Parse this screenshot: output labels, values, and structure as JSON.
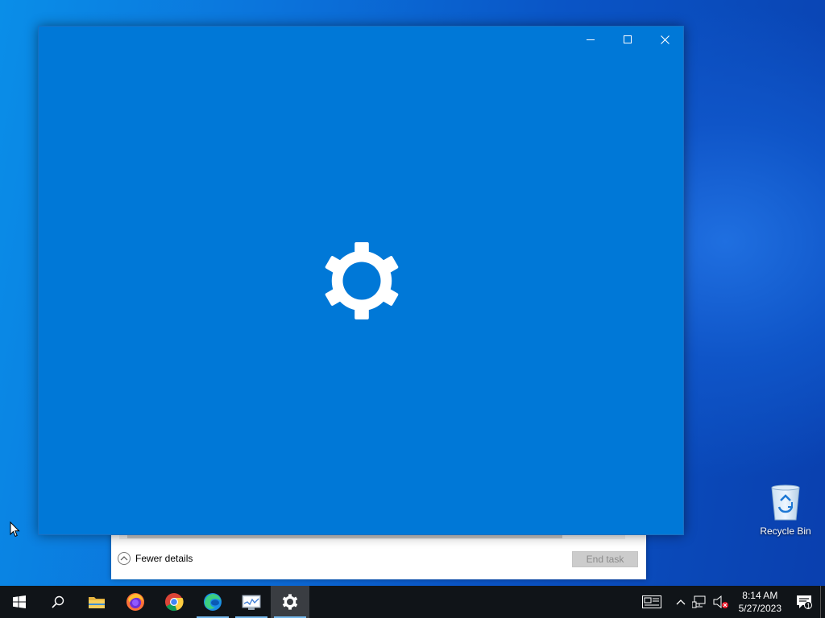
{
  "desktop": {
    "icons": [
      {
        "label": "Recycle Bin",
        "icon": "recycle-bin-icon"
      }
    ]
  },
  "task_manager": {
    "fewer_details_label": "Fewer details",
    "end_task_label": "End task"
  },
  "settings_window": {
    "splash_icon": "gear-icon",
    "background_color": "#0078d7",
    "controls": {
      "minimize": "minimize-icon",
      "maximize": "maximize-icon",
      "close": "close-icon"
    }
  },
  "taskbar": {
    "apps": [
      {
        "name": "start",
        "icon": "windows-logo-icon"
      },
      {
        "name": "search",
        "icon": "search-icon"
      },
      {
        "name": "file-explorer",
        "icon": "folder-icon"
      },
      {
        "name": "firefox",
        "icon": "firefox-icon"
      },
      {
        "name": "chrome",
        "icon": "chrome-icon"
      },
      {
        "name": "edge",
        "icon": "edge-icon",
        "running": true
      },
      {
        "name": "task-manager",
        "icon": "task-manager-icon",
        "running": true
      },
      {
        "name": "settings",
        "icon": "gear-icon",
        "running": true,
        "active": true
      }
    ],
    "tray": {
      "time": "8:14 AM",
      "date": "5/27/2023",
      "notification_count": "1"
    }
  }
}
